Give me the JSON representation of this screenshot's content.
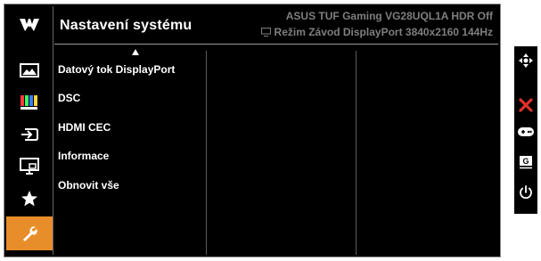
{
  "header": {
    "title": "Nastavení systému",
    "model_line": "ASUS TUF Gaming VG28UQL1A  HDR Off",
    "mode_line": "Režim Závod DisplayPort 3840x2160 144Hz"
  },
  "sidebar": {
    "items": [
      {
        "icon": "image-icon"
      },
      {
        "icon": "color-bars-icon"
      },
      {
        "icon": "input-source-icon"
      },
      {
        "icon": "pip-icon"
      },
      {
        "icon": "star-icon"
      },
      {
        "icon": "wrench-icon",
        "active": true
      }
    ]
  },
  "menu": {
    "items": [
      "Datový tok DisplayPort",
      "DSC",
      "HDMI CEC",
      "Informace",
      "Obnovit vše"
    ]
  },
  "right_panel": {
    "icons": [
      "move-dpad-icon",
      "close-icon",
      "gamepad-icon",
      "gameplus-icon",
      "power-icon"
    ],
    "gameplus_label": "G"
  },
  "colors": {
    "active_tab": "#e78e2a",
    "close": "#e0312b",
    "dim_text": "#7f7f7f"
  }
}
